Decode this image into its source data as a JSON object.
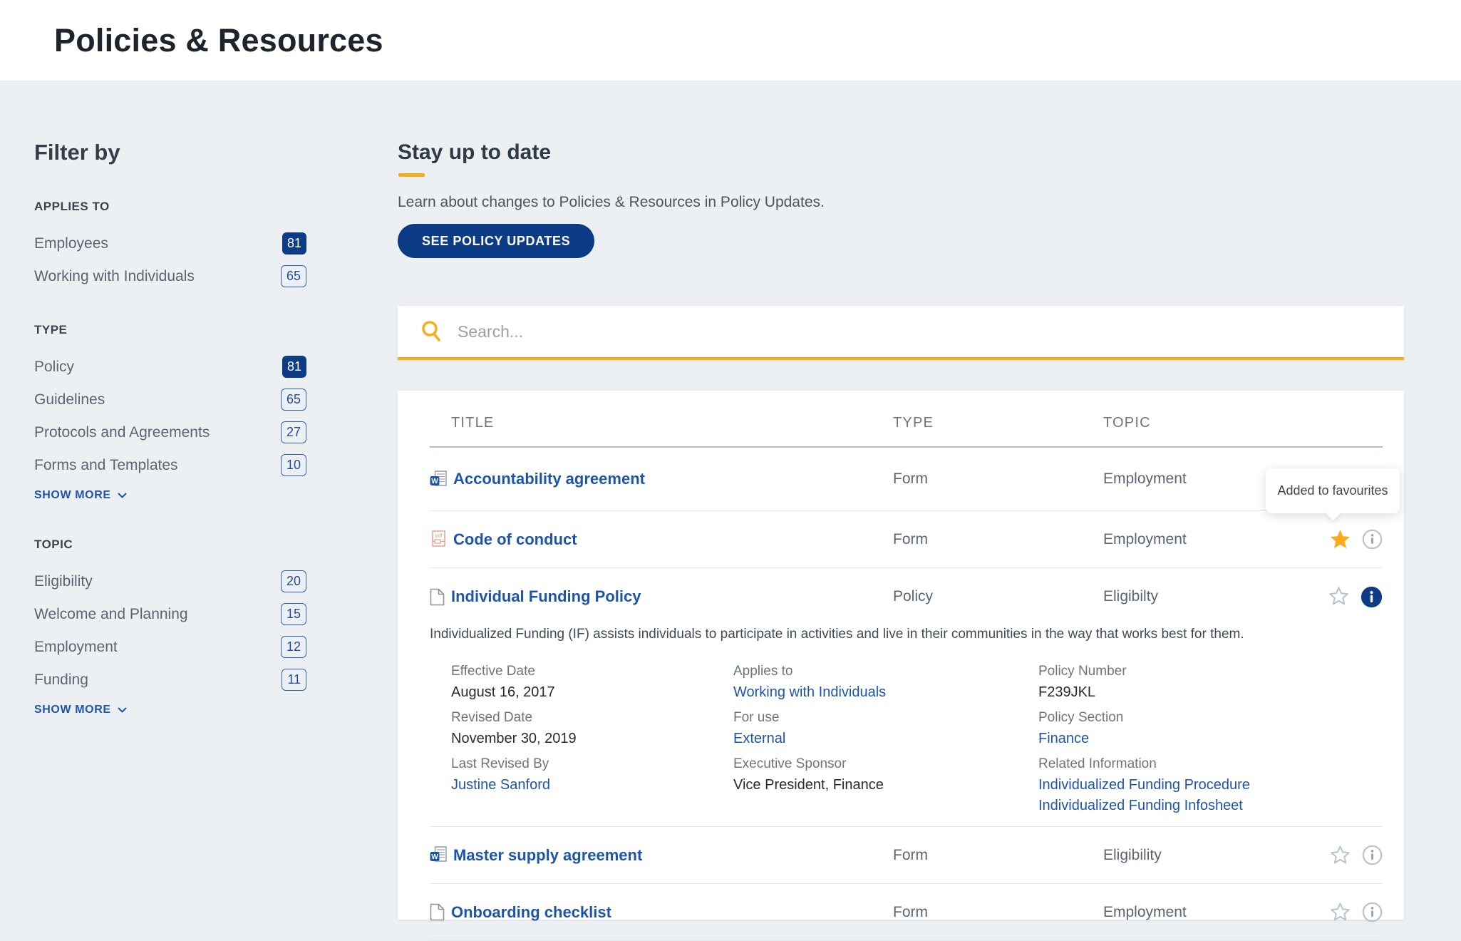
{
  "header": {
    "title": "Policies & Resources"
  },
  "sidebar": {
    "title": "Filter by",
    "groups": [
      {
        "label": "APPLIES TO",
        "items": [
          {
            "label": "Employees",
            "count": "81",
            "selected": true
          },
          {
            "label": "Working with Individuals",
            "count": "65",
            "selected": false
          }
        ]
      },
      {
        "label": "TYPE",
        "items": [
          {
            "label": "Policy",
            "count": "81",
            "selected": true
          },
          {
            "label": "Guidelines",
            "count": "65",
            "selected": false
          },
          {
            "label": "Protocols and Agreements",
            "count": "27",
            "selected": false
          },
          {
            "label": "Forms and Templates",
            "count": "10",
            "selected": false
          }
        ],
        "show_more": "SHOW MORE"
      },
      {
        "label": "TOPIC",
        "items": [
          {
            "label": "Eligibility",
            "count": "20",
            "selected": false
          },
          {
            "label": "Welcome and Planning",
            "count": "15",
            "selected": false
          },
          {
            "label": "Employment",
            "count": "12",
            "selected": false
          },
          {
            "label": "Funding",
            "count": "11",
            "selected": false
          }
        ],
        "show_more": "SHOW MORE"
      }
    ]
  },
  "main": {
    "stay_up_to_date": {
      "heading": "Stay up to date",
      "text": "Learn about changes to Policies & Resources in Policy Updates.",
      "button": "SEE POLICY UPDATES"
    },
    "search": {
      "placeholder": "Search..."
    }
  },
  "table": {
    "columns": [
      "TITLE",
      "TYPE",
      "TOPIC"
    ],
    "rows": [
      {
        "title": "Accountability agreement",
        "type": "Form",
        "topic": "Employment",
        "icon": "word-document",
        "favourited": false,
        "info_open": false
      },
      {
        "title": "Code of conduct",
        "type": "Form",
        "topic": "Employment",
        "icon": "pdf-document",
        "favourited": true,
        "info_open": false
      },
      {
        "title": "Individual Funding Policy",
        "type": "Policy",
        "topic": "Eligibilty",
        "icon": "document",
        "favourited": false,
        "info_open": true
      },
      {
        "title": "Master supply agreement",
        "type": "Form",
        "topic": "Eligibility",
        "icon": "word-document",
        "favourited": false,
        "info_open": false
      },
      {
        "title": "Onboarding checklist",
        "type": "Form",
        "topic": "Employment",
        "icon": "document",
        "favourited": false,
        "info_open": false
      }
    ]
  },
  "tooltip": {
    "text": "Added to favourites"
  },
  "expanded": {
    "description": "Individualized Funding (IF) assists individuals to participate in activities and live in their communities in the way that works best for them.",
    "columns": [
      {
        "fields": [
          {
            "label": "Effective Date",
            "value": "August 16, 2017",
            "is_link": false
          },
          {
            "label": "Revised Date",
            "value": "November 30, 2019",
            "is_link": false
          },
          {
            "label": "Last Revised By",
            "value": "Justine Sanford",
            "is_link": true
          }
        ]
      },
      {
        "fields": [
          {
            "label": "Applies to",
            "value": "Working with Individuals",
            "is_link": true
          },
          {
            "label": "For use",
            "value": "External",
            "is_link": true
          },
          {
            "label": "Executive Sponsor",
            "value": "Vice President, Finance",
            "is_link": false
          }
        ]
      },
      {
        "fields": [
          {
            "label": "Policy Number",
            "value": "F239JKL",
            "is_link": false
          },
          {
            "label": "Policy Section",
            "value": "Finance",
            "is_link": true
          },
          {
            "label": "Related Information",
            "value": "Individualized Funding Procedure",
            "value2": "Individualized Funding Infosheet",
            "is_link": true
          }
        ]
      }
    ]
  },
  "colors": {
    "navy": "#0d3c86",
    "link": "#1e55a9",
    "amber": "#f9ab18",
    "page_background": "#edf0f3"
  }
}
